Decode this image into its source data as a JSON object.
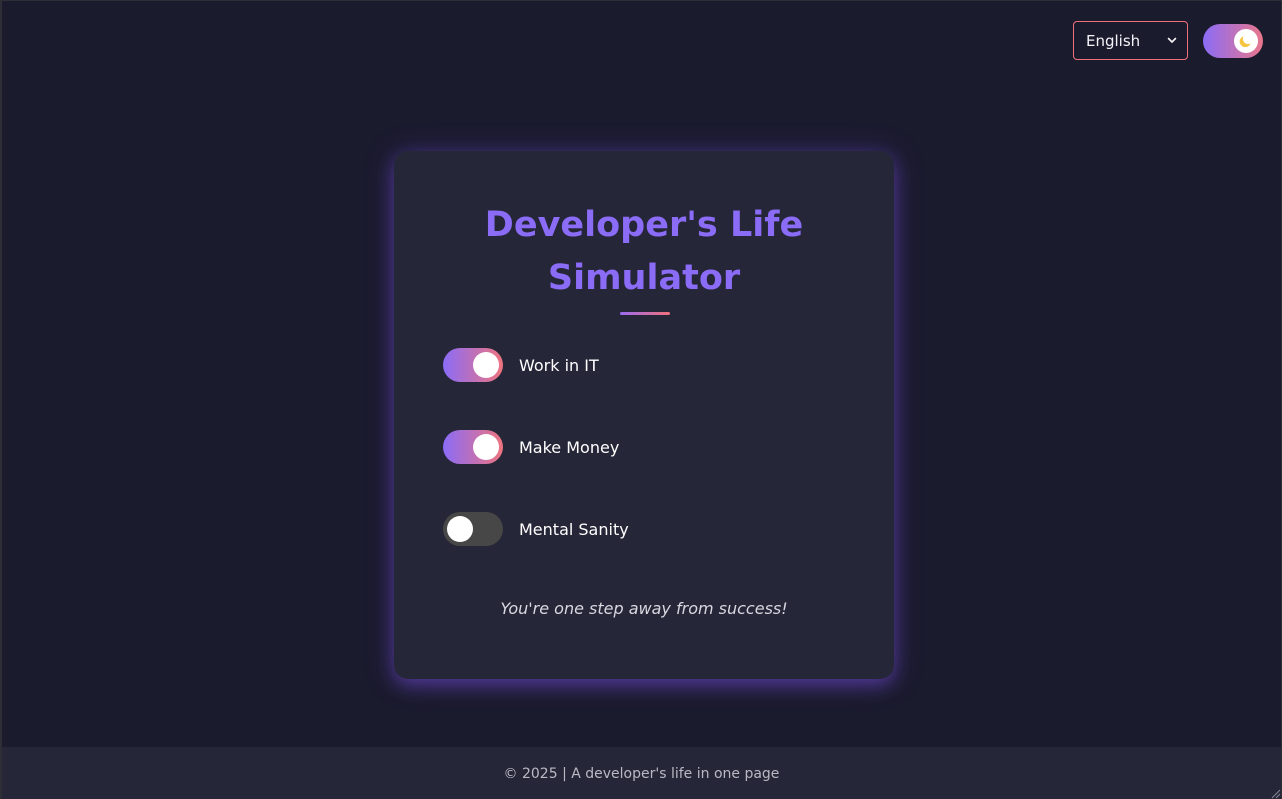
{
  "header": {
    "language_select": {
      "selected": "English",
      "icon": "chevron-down-icon"
    },
    "theme_toggle": {
      "state": "dark",
      "icon": "moon-icon"
    }
  },
  "card": {
    "title_line1": "Developer's Life",
    "title_line2": "Simulator",
    "options": [
      {
        "label": "Work in IT",
        "enabled": true
      },
      {
        "label": "Make Money",
        "enabled": true
      },
      {
        "label": "Mental Sanity",
        "enabled": false
      }
    ],
    "status_message": "You're one step away from success!"
  },
  "footer": {
    "text": "© 2025 | A developer's life in one page"
  },
  "colors": {
    "background": "#1b1b2e",
    "card": "#262639",
    "accent_purple": "#8b6cf7",
    "accent_coral": "#f0707a",
    "switch_off": "#474747"
  }
}
